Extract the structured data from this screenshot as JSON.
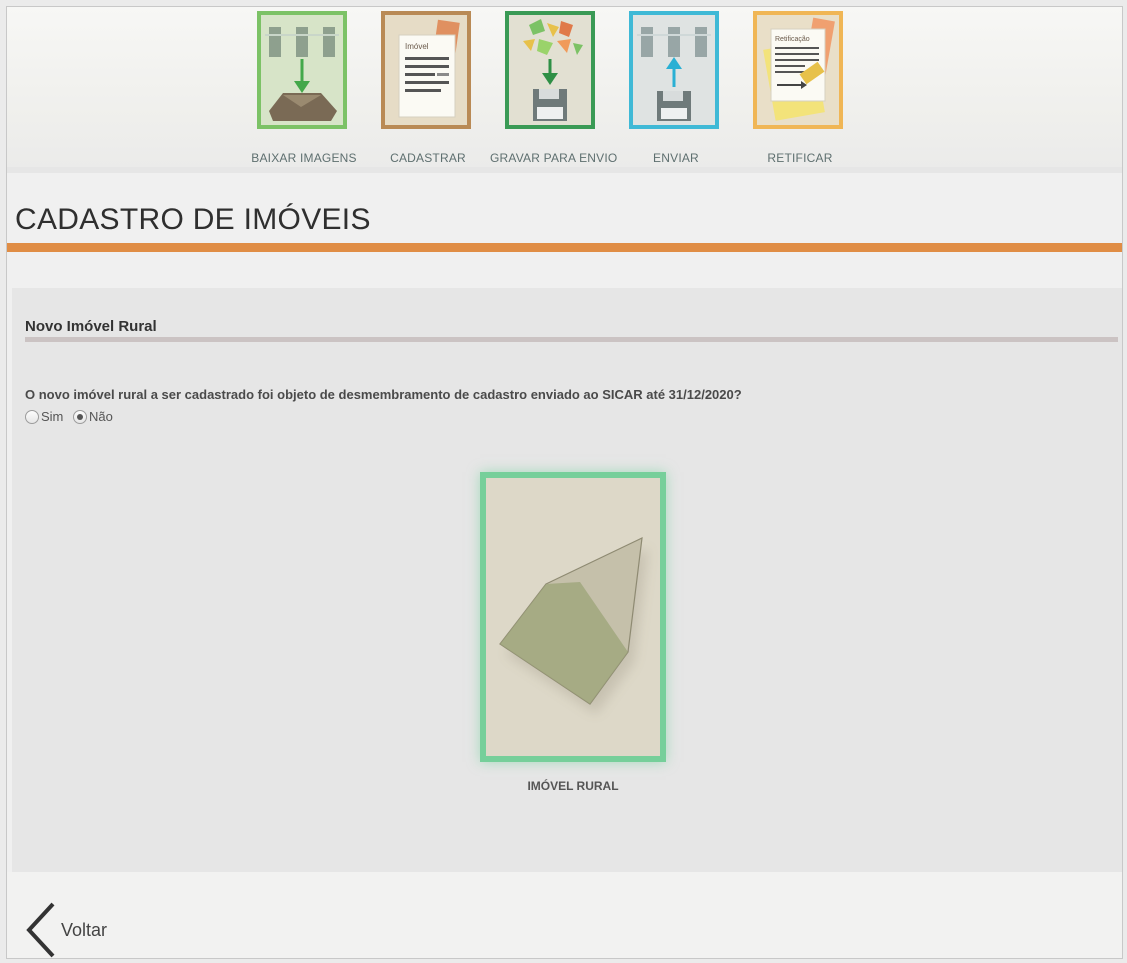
{
  "nav": {
    "items": [
      {
        "label": "BAIXAR IMAGENS",
        "icon": "download-images-icon"
      },
      {
        "label": "CADASTRAR",
        "icon": "register-document-icon",
        "doc_text": "Imóvel"
      },
      {
        "label": "GRAVAR PARA ENVIO",
        "icon": "save-floppy-icon"
      },
      {
        "label": "ENVIAR",
        "icon": "upload-servers-icon"
      },
      {
        "label": "RETIFICAR",
        "icon": "rectify-document-icon",
        "doc_text": "Retificação"
      }
    ]
  },
  "page": {
    "title": "CADASTRO DE IMÓVEIS"
  },
  "section": {
    "title": "Novo Imóvel Rural",
    "question": "O novo imóvel rural a ser cadastrado foi objeto de desmembramento de cadastro enviado ao SICAR até 31/12/2020?",
    "options": [
      {
        "label": "Sim",
        "checked": false
      },
      {
        "label": "Não",
        "checked": true
      }
    ]
  },
  "card": {
    "label": "IMÓVEL RURAL",
    "icon": "rural-property-polygon-icon"
  },
  "footer": {
    "back_label": "Voltar"
  },
  "colors": {
    "accent_orange": "#e08d45",
    "card_border": "#76cf9a"
  }
}
